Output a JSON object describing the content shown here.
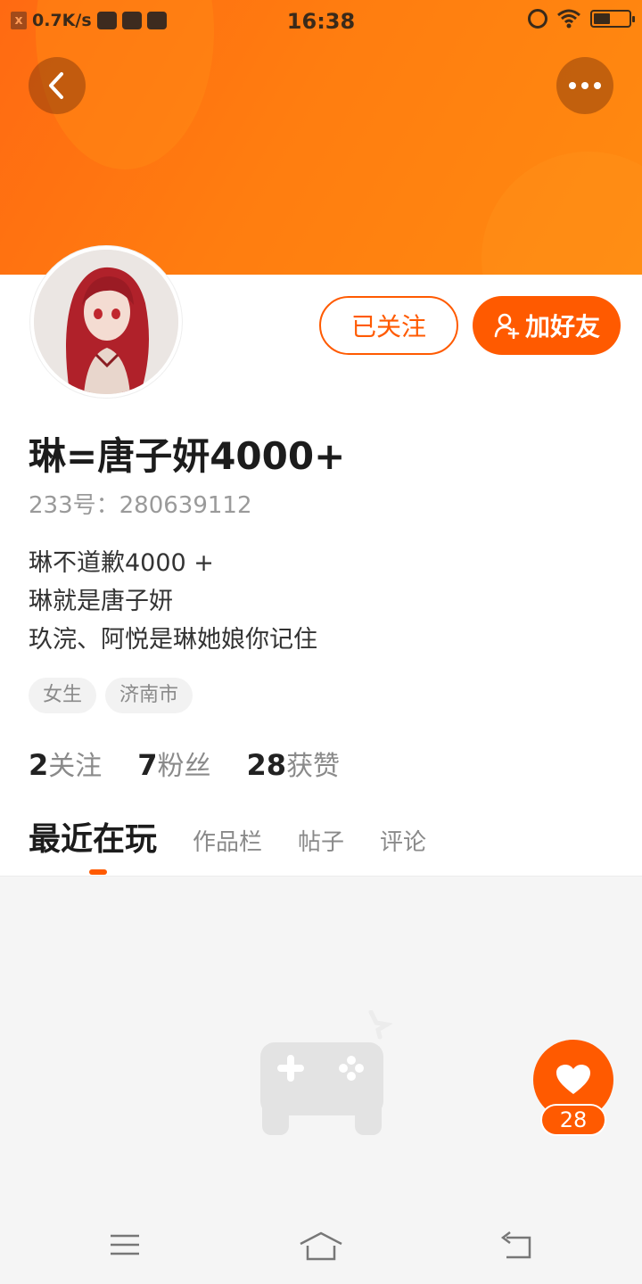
{
  "status_bar": {
    "net_speed": "0.7K/s",
    "time": "16:38"
  },
  "header": {
    "back_icon": "chevron-left-icon",
    "more_icon": "more-dots-icon",
    "colors": {
      "gradient_start": "#ff6a12",
      "gradient_end": "#ff8a10"
    }
  },
  "profile": {
    "follow_label": "已关注",
    "add_friend_label": "加好友",
    "username": "琳=唐子妍4000+",
    "uid": "233号：280639112",
    "bio": [
      "琳不道歉4000 +",
      "琳就是唐子妍",
      "玖浣、阿悦是琳她娘你记住"
    ],
    "tags": [
      "女生",
      "济南市"
    ],
    "stats": [
      {
        "value": "2",
        "label": "关注"
      },
      {
        "value": "7",
        "label": "粉丝"
      },
      {
        "value": "28",
        "label": "获赞"
      }
    ]
  },
  "tabs": [
    {
      "label": "最近在玩",
      "active": true
    },
    {
      "label": "作品栏"
    },
    {
      "label": "帖子"
    },
    {
      "label": "评论"
    }
  ],
  "like_fab": {
    "count": "28",
    "icon": "heart-icon"
  },
  "accent_color": "#ff5a00",
  "nav_bar": {
    "icons": [
      "menu-icon",
      "home-icon",
      "back-icon"
    ]
  }
}
